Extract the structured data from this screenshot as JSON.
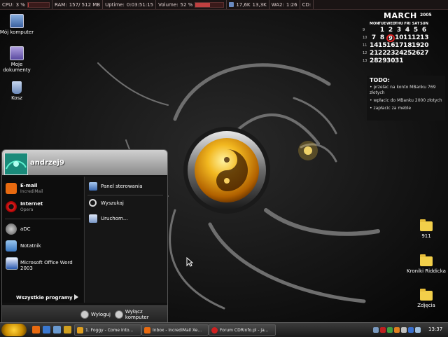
{
  "topbar": {
    "cpu_label": "CPU:",
    "cpu_value": "3 %",
    "ram_label": "RAM:",
    "ram_value": "157/ 512 MB",
    "uptime_label": "Uptime:",
    "uptime_value": "0:03:51:15",
    "volume_label": "Volume:",
    "volume_value": "52 %",
    "net_down": "17,6K",
    "net_up": "13,3K",
    "wa2_label": "WA2:",
    "wa2_value": "1:26",
    "cd_label": "CD:",
    "cpu_fraction": 0.03,
    "ram_fraction": 0.31,
    "volume_fraction": 0.52
  },
  "desktop_icons": [
    {
      "label": "Mój komputer",
      "icon": "my-computer-icon"
    },
    {
      "label": "Moje dokumenty",
      "icon": "my-documents-icon"
    },
    {
      "label": "Kosz",
      "icon": "recycle-bin-icon"
    },
    {
      "label": "911",
      "icon": "folder-icon"
    },
    {
      "label": "Kroniki Riddicka",
      "icon": "folder-icon"
    },
    {
      "label": "Zdjęcia",
      "icon": "folder-icon"
    }
  ],
  "calendar": {
    "month": "MARCH",
    "year": "2005",
    "days": [
      "MON",
      "TUE",
      "WED",
      "THU",
      "FRI",
      "SAT",
      "SUN"
    ],
    "weeks": [
      "9",
      "10",
      "11",
      "12",
      "13"
    ],
    "rows": [
      [
        "",
        "1",
        "2",
        "3",
        "4",
        "5",
        "6"
      ],
      [
        "7",
        "8",
        "9",
        "10",
        "11",
        "12",
        "13"
      ],
      [
        "14",
        "15",
        "16",
        "17",
        "18",
        "19",
        "20"
      ],
      [
        "21",
        "22",
        "23",
        "24",
        "25",
        "26",
        "27"
      ],
      [
        "28",
        "29",
        "30",
        "31",
        "",
        "",
        ""
      ]
    ],
    "today": "9",
    "highlight_color": "#e02020"
  },
  "todo": {
    "title": "TODO:",
    "items": [
      "• przelac na konto MBanku 769 złotych",
      "• wpłacic do MBanku 2000 złotych",
      "• zapłacic za meble"
    ]
  },
  "start_menu": {
    "username": "andrzej9",
    "pinned": [
      {
        "title": "E-mail",
        "subtitle": "IncrediMail",
        "icon": "email-icon"
      },
      {
        "title": "Internet",
        "subtitle": "Opera",
        "icon": "opera-icon"
      }
    ],
    "recent": [
      {
        "title": "aDC",
        "icon": "adc-icon"
      },
      {
        "title": "Notatnik",
        "icon": "notepad-icon"
      },
      {
        "title": "Microsoft Office Word 2003",
        "icon": "word-icon"
      }
    ],
    "right_items": [
      {
        "title": "Panel sterowania",
        "icon": "control-panel-icon"
      },
      {
        "title": "Wyszukaj",
        "icon": "search-icon"
      },
      {
        "title": "Uruchom...",
        "icon": "run-icon"
      }
    ],
    "all_programs": "Wszystkie programy",
    "logoff": "Wyloguj",
    "shutdown": "Wyłącz komputer"
  },
  "taskbar": {
    "tasks": [
      {
        "label": "1. Foggy - Come Into...",
        "icon": "winamp-icon"
      },
      {
        "label": "Inbox - IncrediMail Xe...",
        "icon": "email-icon"
      },
      {
        "label": "Forum CDRinfo.pl - ja...",
        "icon": "opera-icon"
      }
    ],
    "clock": "13:37"
  },
  "colors": {
    "accent": "#f2b820",
    "today_ring": "#e02020",
    "folder": "#f2cf4a"
  }
}
